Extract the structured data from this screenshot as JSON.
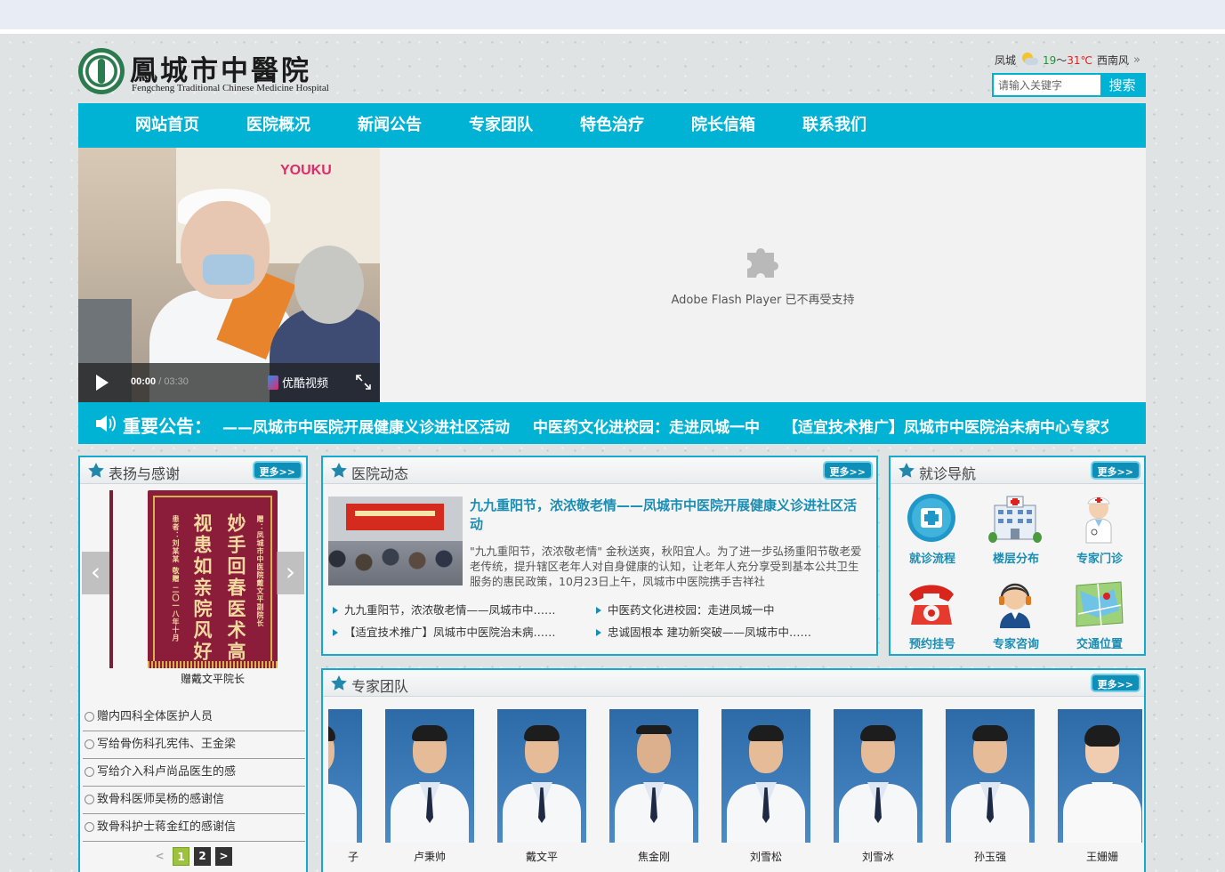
{
  "header": {
    "logo_cn": "鳳城市中醫院",
    "logo_en": "Fengcheng Traditional Chinese Medicine Hospital",
    "weather": {
      "city": "凤城",
      "temp_low": "19",
      "sep": "～",
      "temp_high": "31℃",
      "wind": "西南风",
      "more": "»"
    },
    "search": {
      "placeholder": "请输入关键字",
      "button": "搜索"
    }
  },
  "nav": [
    "网站首页",
    "医院概况",
    "新闻公告",
    "专家团队",
    "特色治疗",
    "院长信箱",
    "联系我们"
  ],
  "video": {
    "brand_logo": "YOUKU",
    "time_current": "00:00",
    "time_sep": " / ",
    "time_total": "03:30",
    "brand_label": "优酷视频"
  },
  "flash": {
    "message": "Adobe Flash Player 已不再受支持"
  },
  "notice": {
    "title": "重要公告：",
    "items": [
      "——凤城市中医院开展健康义诊进社区活动",
      "中医药文化进校园：走进凤城一中",
      "【适宜技术推广】凤城市中医院治未病中心专家交"
    ]
  },
  "thanks": {
    "title": "表扬与感谢",
    "more": "更多>>",
    "banner": {
      "line1": "妙手回春医术高",
      "line2": "视患如亲院风好",
      "inscription_right": "赠：凤城市中医院戴文平副院长",
      "inscription_left": "患者：刘某某 敬赠 二〇一八年十月",
      "caption": "赠戴文平院长"
    },
    "items": [
      "赠内四科全体医护人员",
      "写给骨伤科孔宪伟、王金梁",
      "写给介入科卢尚品医生的感",
      "致骨科医师吴杨的感谢信",
      "致骨科护士蒋金红的感谢信"
    ],
    "pager": {
      "prev": "<",
      "pages": [
        "1",
        "2"
      ],
      "next": ">"
    }
  },
  "news": {
    "title": "医院动态",
    "more": "更多>>",
    "headline": "九九重阳节，浓浓敬老情——凤城市中医院开展健康义诊进社区活动",
    "summary": "\"九九重阳节，浓浓敬老情\" 金秋送爽，秋阳宜人。为了进一步弘扬重阳节敬老爱老传统，提升辖区老年人对自身健康的认知，让老年人充分享受到基本公共卫生服务的惠民政策，10月23日上午，凤城市中医院携手吉祥社",
    "links": [
      "九九重阳节，浓浓敬老情——凤城市中……",
      "中医药文化进校园：走进凤城一中",
      "【适宜技术推广】凤城市中医院治未病……",
      "忠诚固根本 建功新突破——凤城市中……"
    ]
  },
  "guide": {
    "title": "就诊导航",
    "more": "更多>>",
    "items": [
      {
        "label": "就诊流程",
        "icon": "hospital-cross-icon"
      },
      {
        "label": "楼层分布",
        "icon": "building-icon"
      },
      {
        "label": "专家门诊",
        "icon": "doctor-icon"
      },
      {
        "label": "预约挂号",
        "icon": "telephone-icon"
      },
      {
        "label": "专家咨询",
        "icon": "headset-support-icon"
      },
      {
        "label": "交通位置",
        "icon": "map-icon"
      }
    ]
  },
  "experts": {
    "title": "专家团队",
    "more": "更多>>",
    "doctors": [
      {
        "name": "子"
      },
      {
        "name": "卢秉帅"
      },
      {
        "name": "戴文平"
      },
      {
        "name": "焦金刚"
      },
      {
        "name": "刘雪松"
      },
      {
        "name": "刘雪冰"
      },
      {
        "name": "孙玉强"
      },
      {
        "name": "王姗姗"
      }
    ]
  },
  "colors": {
    "brand": "#00b2d4",
    "panel_border": "#14a9cf",
    "link": "#1b8db3",
    "more_button": "#0d8fb8",
    "banner_red": "#8b1c3a"
  }
}
